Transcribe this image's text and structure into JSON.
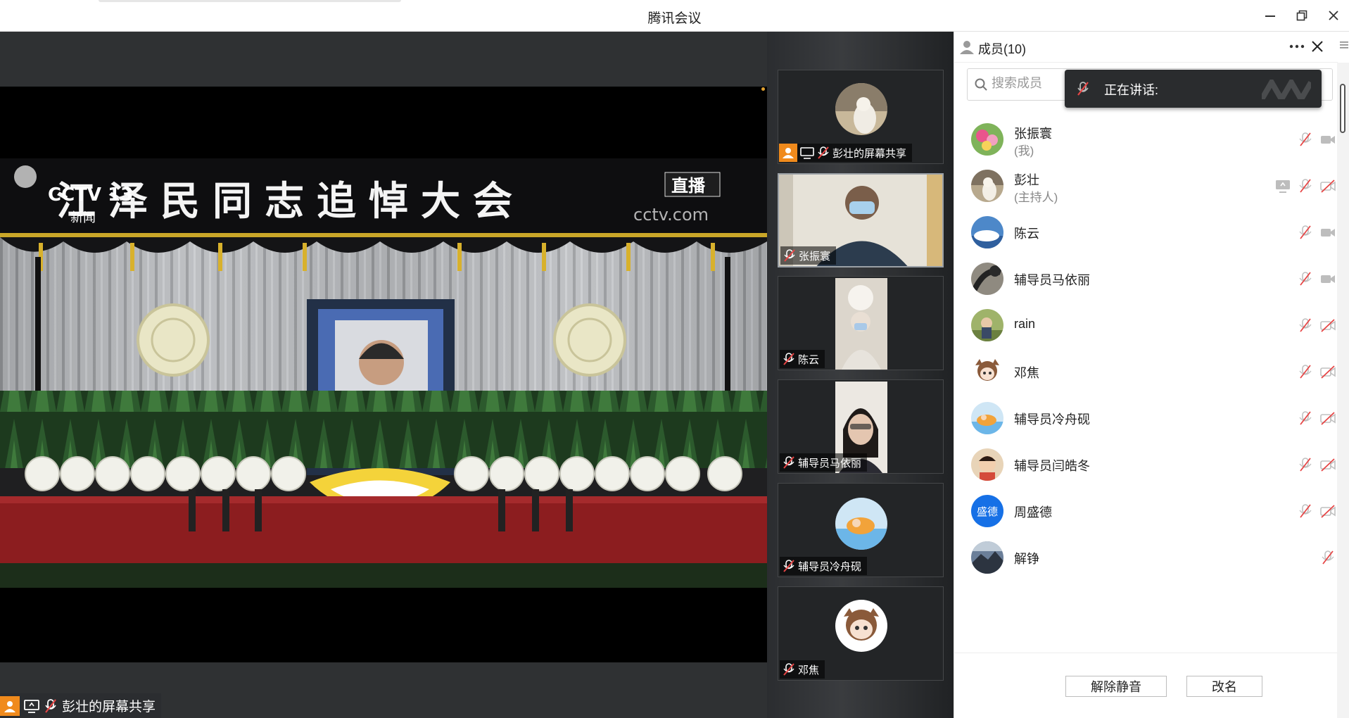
{
  "window": {
    "title": "腾讯会议"
  },
  "stage": {
    "share_badge": "彭壮的屏幕共享",
    "broadcast": {
      "banner_text": "江泽民同志追悼大会",
      "channel_logo": "CCTV 13",
      "channel_sub": "新闻",
      "live_tag": "直播",
      "watermark": "cctv.com"
    }
  },
  "video_tiles": [
    {
      "name": "彭壮的屏幕共享",
      "type": "share"
    },
    {
      "name": "张振寰",
      "type": "camera"
    },
    {
      "name": "陈云",
      "type": "camera"
    },
    {
      "name": "辅导员马依丽",
      "type": "camera"
    },
    {
      "name": "辅导员冷舟砚",
      "type": "avatar"
    },
    {
      "name": "邓焦",
      "type": "avatar"
    }
  ],
  "panel": {
    "title": "成员(10)",
    "search_placeholder": "搜索成员",
    "speaking_label": "正在讲话:",
    "members": [
      {
        "name": "张振寰",
        "sub": "(我)",
        "mic_muted": true,
        "cam_muted": false,
        "sharing": false
      },
      {
        "name": "彭壮",
        "sub": "(主持人)",
        "mic_muted": true,
        "cam_muted": true,
        "sharing": true
      },
      {
        "name": "陈云",
        "sub": "",
        "mic_muted": true,
        "cam_muted": false,
        "sharing": false
      },
      {
        "name": "辅导员马依丽",
        "sub": "",
        "mic_muted": true,
        "cam_muted": false,
        "sharing": false
      },
      {
        "name": "rain",
        "sub": "",
        "mic_muted": true,
        "cam_muted": true,
        "sharing": false
      },
      {
        "name": "邓焦",
        "sub": "",
        "mic_muted": true,
        "cam_muted": true,
        "sharing": false
      },
      {
        "name": "辅导员冷舟砚",
        "sub": "",
        "mic_muted": true,
        "cam_muted": true,
        "sharing": false
      },
      {
        "name": "辅导员闫皓冬",
        "sub": "",
        "mic_muted": true,
        "cam_muted": true,
        "sharing": false
      },
      {
        "name": "周盛德",
        "sub": "",
        "avatar_text": "盛德",
        "mic_muted": true,
        "cam_muted": true,
        "sharing": false
      },
      {
        "name": "解铮",
        "sub": "",
        "mic_muted": true,
        "sharing": false
      }
    ],
    "unmute_button": "解除静音",
    "rename_button": "改名"
  },
  "colors": {
    "accent": "#f08a1c",
    "avatar_blue": "#1670e6",
    "muted_red": "#e64545"
  }
}
